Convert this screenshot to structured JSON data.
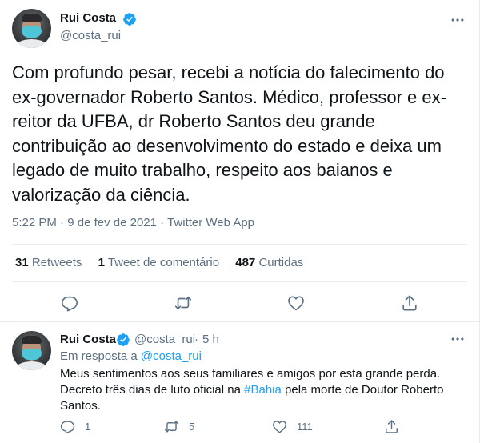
{
  "main_tweet": {
    "author": {
      "name": "Rui Costa",
      "handle": "@costa_rui"
    },
    "text": "Com profundo pesar, recebi a notícia do falecimento do ex-governador Roberto Santos. Médico, professor e ex-reitor da UFBA, dr Roberto Santos deu grande contribuição ao desenvolvimento do estado e deixa um legado de muito trabalho, respeito aos baianos e valorização da ciência.",
    "time": "5:22 PM",
    "dot1": "·",
    "date": "9 de fev de 2021",
    "dot2": "·",
    "source": "Twitter Web App",
    "stats": {
      "retweets_count": "31",
      "retweets_label": "Retweets",
      "quotes_count": "1",
      "quotes_label": "Tweet de comentário",
      "likes_count": "487",
      "likes_label": "Curtidas"
    },
    "actions": [
      "reply-icon",
      "retweet-icon",
      "like-icon",
      "share-icon"
    ]
  },
  "reply_tweet": {
    "author": {
      "name": "Rui Costa",
      "handle": "@costa_rui",
      "dot": "·",
      "time": "5 h"
    },
    "replying_to_label": "Em resposta a",
    "replying_to_handle": "@costa_rui",
    "text_before": "Meus sentimentos aos seus familiares e amigos por esta grande perda. Decreto três dias de luto oficial na ",
    "hashtag": "#Bahia",
    "text_after": " pela morte de Doutor Roberto Santos.",
    "counts": {
      "replies": "1",
      "retweets": "5",
      "likes": "111"
    }
  },
  "colors": {
    "accent": "#1da1f2",
    "secondary_text": "#5b7083",
    "primary_text": "#0f1419",
    "divider": "#e6ecf0"
  }
}
